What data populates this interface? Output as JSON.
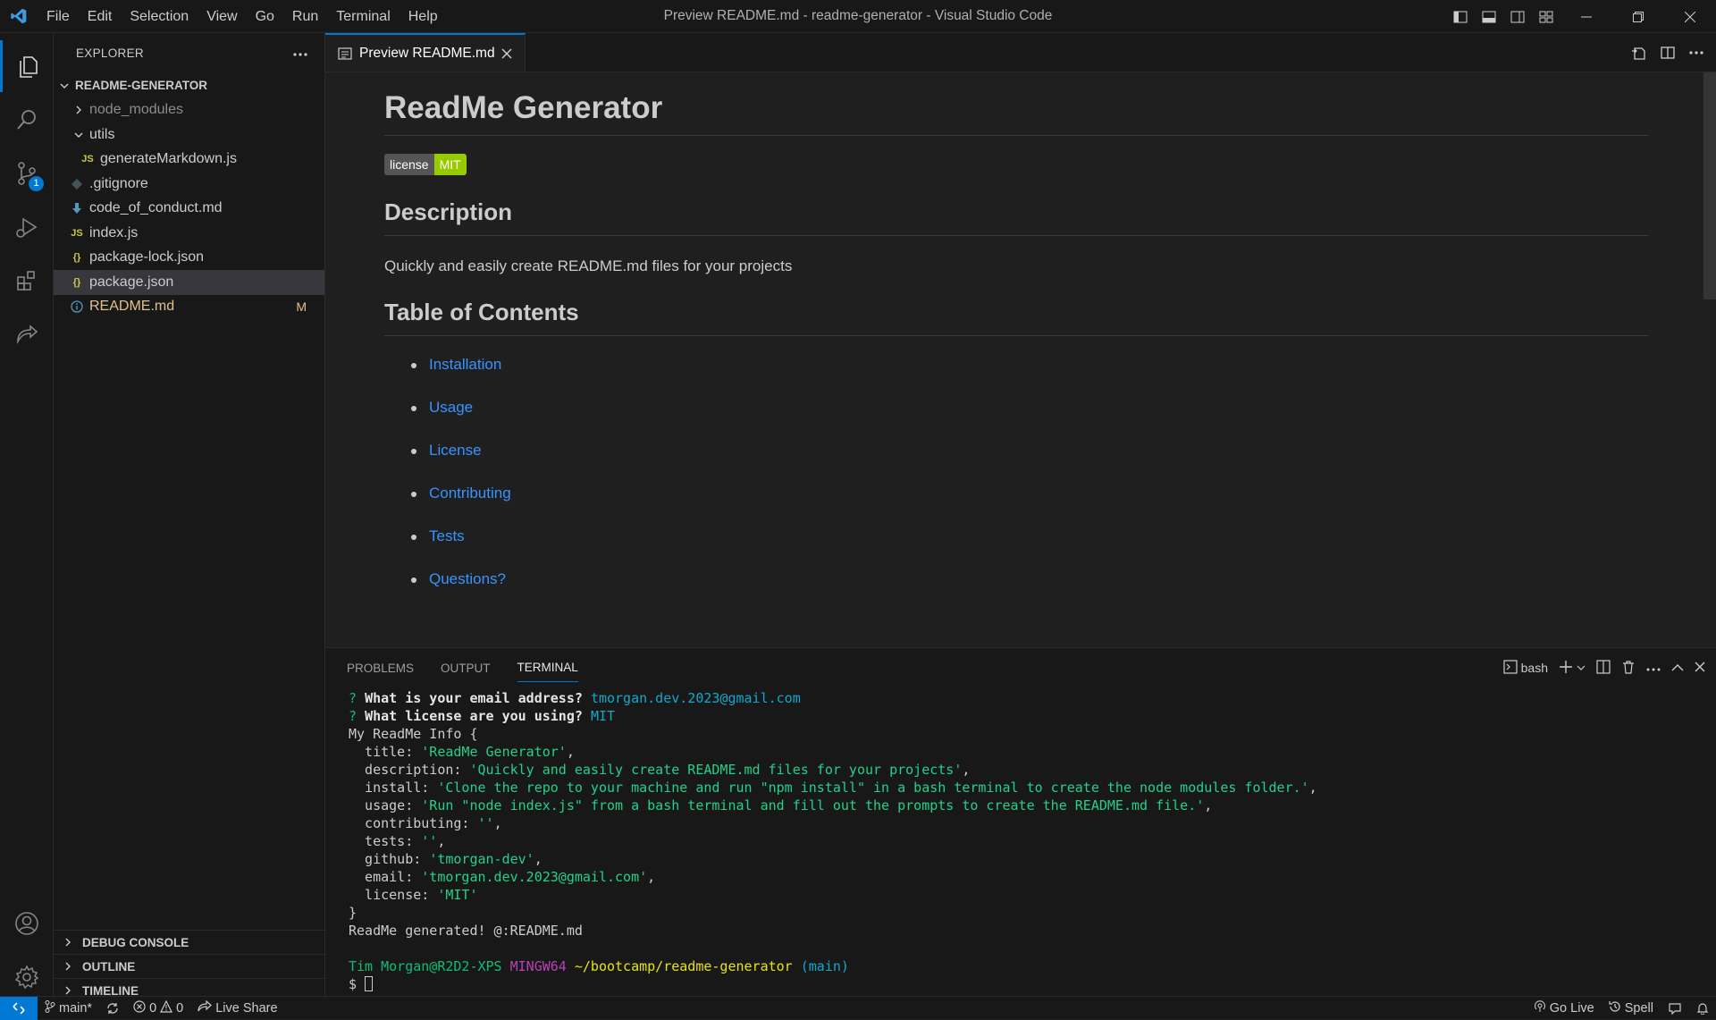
{
  "window": {
    "title": "Preview README.md - readme-generator - Visual Studio Code"
  },
  "menu": [
    "File",
    "Edit",
    "Selection",
    "View",
    "Go",
    "Run",
    "Terminal",
    "Help"
  ],
  "activity": {
    "scm_badge": "1"
  },
  "explorer": {
    "header": "EXPLORER",
    "folder": "README-GENERATOR",
    "items": [
      {
        "label": "node_modules",
        "kind": "folder-collapsed"
      },
      {
        "label": "utils",
        "kind": "folder-expanded"
      },
      {
        "label": "generateMarkdown.js",
        "kind": "js",
        "icon": "JS"
      },
      {
        "label": ".gitignore",
        "kind": "git"
      },
      {
        "label": "code_of_conduct.md",
        "kind": "md"
      },
      {
        "label": "index.js",
        "kind": "js",
        "icon": "JS"
      },
      {
        "label": "package-lock.json",
        "kind": "json",
        "icon": "{}"
      },
      {
        "label": "package.json",
        "kind": "json",
        "icon": "{}"
      },
      {
        "label": "README.md",
        "kind": "info",
        "status": "M"
      }
    ],
    "sections": [
      "DEBUG CONSOLE",
      "OUTLINE",
      "TIMELINE"
    ]
  },
  "tab": {
    "label": "Preview README.md"
  },
  "preview": {
    "title": "ReadMe Generator",
    "badge_left": "license",
    "badge_right": "MIT",
    "h_description": "Description",
    "description": "Quickly and easily create README.md files for your projects",
    "h_toc": "Table of Contents",
    "toc": [
      "Installation",
      "Usage",
      "License",
      "Contributing",
      "Tests",
      "Questions?"
    ]
  },
  "panel": {
    "tabs": [
      "PROBLEMS",
      "OUTPUT",
      "TERMINAL"
    ],
    "active_tab": "TERMINAL",
    "shell": "bash"
  },
  "terminal": {
    "q1_mark": "?",
    "q1": "What is your email address?",
    "a1": "tmorgan.dev.2023@gmail.com",
    "q2_mark": "?",
    "q2": "What license are you using?",
    "a2": "MIT",
    "obj_open": "My ReadMe Info {",
    "fields": [
      {
        "key": "  title: ",
        "value": "'ReadMe Generator'",
        "tail": ","
      },
      {
        "key": "  description: ",
        "value": "'Quickly and easily create README.md files for your projects'",
        "tail": ","
      },
      {
        "key": "  install: ",
        "value": "'Clone the repo to your machine and run \"npm install\" in a bash terminal to create the node modules folder.'",
        "tail": ","
      },
      {
        "key": "  usage: ",
        "value": "'Run \"node index.js\" from a bash terminal and fill out the prompts to create the README.md file.'",
        "tail": ","
      },
      {
        "key": "  contributing: ",
        "value": "''",
        "tail": ","
      },
      {
        "key": "  tests: ",
        "value": "''",
        "tail": ","
      },
      {
        "key": "  github: ",
        "value": "'tmorgan-dev'",
        "tail": ","
      },
      {
        "key": "  email: ",
        "value": "'tmorgan.dev.2023@gmail.com'",
        "tail": ","
      },
      {
        "key": "  license: ",
        "value": "'MIT'",
        "tail": ""
      }
    ],
    "obj_close": "}",
    "done": "ReadMe generated! @:README.md",
    "prompt_user": "Tim Morgan@R2D2-XPS",
    "prompt_env": "MINGW64",
    "prompt_path": "~/bootcamp/readme-generator",
    "prompt_branch": "(main)",
    "prompt_symbol": "$ "
  },
  "statusbar": {
    "branch": "main*",
    "errors": "0",
    "warnings": "0",
    "live_share": "Live Share",
    "go_live": "Go Live",
    "spell": "Spell"
  }
}
